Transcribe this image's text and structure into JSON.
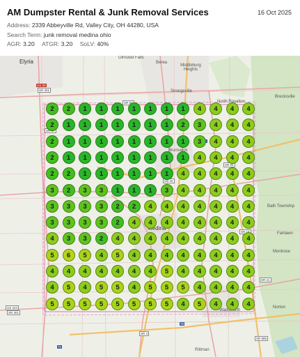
{
  "header": {
    "title": "AM Dumpster Rental & Junk Removal Services",
    "date": "16 Oct 2025",
    "address_label": "Address:",
    "address_value": "2339 Abbeyville Rd, Valley City, OH 44280, USA",
    "search_label": "Search Term:",
    "search_value": "junk removal medina ohio",
    "agr_label": "AGR:",
    "agr_value": "3.20",
    "atgr_label": "ATGR:",
    "atgr_value": "3.20",
    "solv_label": "SoLV:",
    "solv_value": "40%"
  },
  "colors": {
    "rank_1": "#2ab52a",
    "rank_2": "#44be22",
    "rank_3": "#5ec41e",
    "rank_4": "#8ccd1c",
    "rank_5": "#a9d41a",
    "rank_6": "#b6d51a",
    "map_bg": "#eef0e8",
    "grid_line": "#e2619a",
    "road_main": "#f2c56b",
    "road_secondary": "#e0a4a4"
  },
  "grid": {
    "rows": 13,
    "cols": 13,
    "ranks": [
      [
        "2",
        "2",
        "1",
        "1",
        "1",
        "1",
        "1",
        "1",
        "1",
        "4",
        "4",
        "4",
        "4"
      ],
      [
        "2",
        "1",
        "1",
        "1",
        "1",
        "1",
        "1",
        "1",
        "2",
        "3",
        "4",
        "4",
        "4"
      ],
      [
        "2",
        "1",
        "1",
        "1",
        "1",
        "1",
        "1",
        "1",
        "1",
        "3",
        "4",
        "4",
        "4"
      ],
      [
        "2",
        "1",
        "1",
        "1",
        "1",
        "1",
        "1",
        "1",
        "1",
        "4",
        "4",
        "4",
        "4"
      ],
      [
        "2",
        "2",
        "1",
        "1",
        "1",
        "1",
        "1",
        "1",
        "4",
        "4",
        "4",
        "4",
        "4"
      ],
      [
        "3",
        "2",
        "3",
        "3",
        "1",
        "1",
        "1",
        "3",
        "4",
        "4",
        "4",
        "4",
        "4"
      ],
      [
        "3",
        "3",
        "3",
        "3",
        "2",
        "2",
        "4",
        "4",
        "4",
        "4",
        "4",
        "4",
        "4"
      ],
      [
        "3",
        "3",
        "3",
        "3",
        "2",
        "4",
        "4",
        "4",
        "4",
        "4",
        "4",
        "4",
        "4"
      ],
      [
        "4",
        "3",
        "3",
        "2",
        "4",
        "4",
        "4",
        "4",
        "4",
        "4",
        "4",
        "4",
        "4"
      ],
      [
        "5",
        "6",
        "5",
        "4",
        "5",
        "4",
        "4",
        "4",
        "4",
        "4",
        "4",
        "4",
        "4"
      ],
      [
        "4",
        "4",
        "4",
        "4",
        "4",
        "4",
        "4",
        "5",
        "4",
        "4",
        "4",
        "4",
        "4"
      ],
      [
        "4",
        "5",
        "4",
        "5",
        "5",
        "4",
        "5",
        "5",
        "5",
        "4",
        "4",
        "4",
        "4"
      ],
      [
        "5",
        "5",
        "5",
        "5",
        "5",
        "5",
        "5",
        "5",
        "4",
        "5",
        "4",
        "4",
        "4"
      ]
    ]
  },
  "map": {
    "places": {
      "elyria": "Elyria",
      "olmsted_falls": "Olmsted Falls",
      "berea": "Berea",
      "middleburg_heights": "Middleburg Heights",
      "strongsville": "Strongsville",
      "north_royalton": "North Royalton",
      "brecksville": "Brecksville",
      "brunswick": "Brunswick",
      "medina": "Medina",
      "bath_township": "Bath Township",
      "fairlawn": "Fairlawn",
      "montrose": "Montrose",
      "norton": "Norton",
      "wadsworth": "Wadsworth",
      "rittman": "Rittman"
    },
    "shields": {
      "us20": "US 20",
      "sr301_top": "SR 301",
      "sr57": "SR 57",
      "sr83": "SR 83",
      "us42": "US 42",
      "sr94": "SR 94",
      "sr18": "SR 18",
      "sr21": "SR 21",
      "us224": "US 224",
      "sr301_bottom": "SR 301",
      "sr3": "SR 3",
      "sr585": "SR 585",
      "i71": "71",
      "i271": "271",
      "i76": "76"
    }
  }
}
